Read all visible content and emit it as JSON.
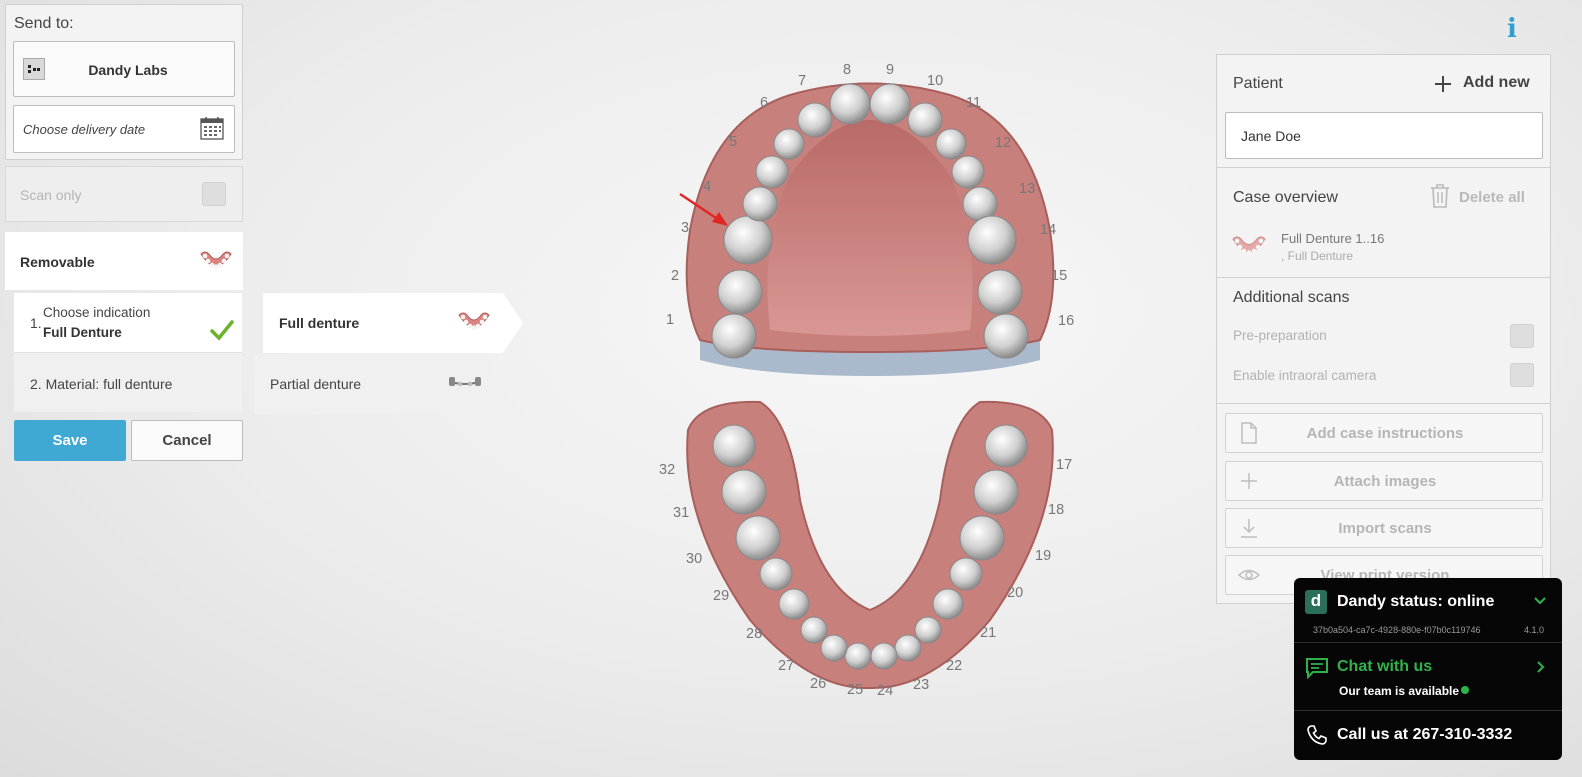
{
  "left_panel": {
    "send_to_label": "Send to:",
    "lab_name": "Dandy Labs",
    "delivery_placeholder": "Choose delivery date",
    "scan_only_label": "Scan only",
    "category_label": "Removable",
    "step1_number": "1.",
    "step1_title": "Choose indication",
    "step1_value": "Full Denture",
    "step2_label": "2. Material: full denture",
    "save_label": "Save",
    "cancel_label": "Cancel"
  },
  "submenu": {
    "full_label": "Full denture",
    "partial_label": "Partial denture"
  },
  "tooth_numbers": [
    "1",
    "2",
    "3",
    "4",
    "5",
    "6",
    "7",
    "8",
    "9",
    "10",
    "11",
    "12",
    "13",
    "14",
    "15",
    "16",
    "17",
    "18",
    "19",
    "20",
    "21",
    "22",
    "23",
    "24",
    "25",
    "26",
    "27",
    "28",
    "29",
    "30",
    "31",
    "32"
  ],
  "right_panel": {
    "patient_label": "Patient",
    "add_new_label": "Add new",
    "patient_name": "Jane Doe",
    "case_overview_label": "Case overview",
    "delete_all_label": "Delete all",
    "case_item_title": "Full Denture  1..16",
    "case_item_sub": ", Full Denture",
    "additional_scans_label": "Additional scans",
    "pre_prep_label": "Pre-preparation",
    "intraoral_label": "Enable intraoral camera",
    "add_instructions_label": "Add case instructions",
    "attach_images_label": "Attach images",
    "import_scans_label": "Import scans",
    "view_print_label": "View print version"
  },
  "status_widget": {
    "logo_letter": "d",
    "title": "Dandy status: online",
    "session_id": "37b0a504-ca7c-4928-880e-f07b0c119746",
    "version": "4.1.0",
    "chat_label": "Chat with us",
    "chat_sub": "Our team is available",
    "call_label": "Call us at 267-310-3332"
  },
  "info_label": "i",
  "colors": {
    "accent": "#3fa9d3",
    "online_green": "#2fb24a",
    "gum": "#c97f7c",
    "tooth": "#d9d9d9"
  }
}
